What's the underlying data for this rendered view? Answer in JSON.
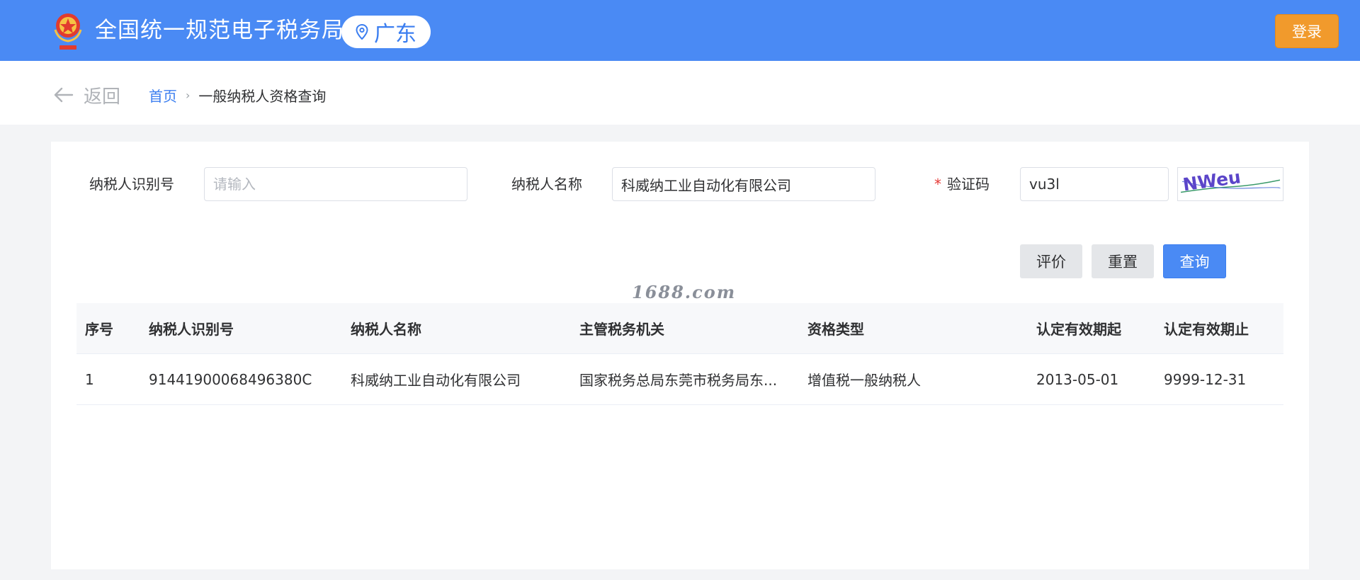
{
  "header": {
    "site_title": "全国统一规范电子税务局",
    "region": "广东",
    "login_label": "登录",
    "brand_color": "#4a8af4"
  },
  "nav": {
    "back_label": "返回",
    "breadcrumb": {
      "home": "首页",
      "separator": "›",
      "current": "一般纳税人资格查询"
    }
  },
  "form": {
    "taxpayer_id": {
      "label": "纳税人识别号",
      "placeholder": "请输入",
      "value": ""
    },
    "taxpayer_name": {
      "label": "纳税人名称",
      "value": "科威纳工业自动化有限公司"
    },
    "captcha": {
      "required_mark": "*",
      "label": "验证码",
      "value": "vu3l",
      "image_text": "NWeu"
    }
  },
  "actions": {
    "evaluate_label": "评价",
    "reset_label": "重置",
    "query_label": "查询"
  },
  "watermark": "1688.com",
  "table": {
    "columns": [
      "序号",
      "纳税人识别号",
      "纳税人名称",
      "主管税务机关",
      "资格类型",
      "认定有效期起",
      "认定有效期止"
    ],
    "rows": [
      [
        "1",
        "91441900068496380C",
        "科威纳工业自动化有限公司",
        "国家税务总局东莞市税务局东...",
        "增值税一般纳税人",
        "2013-05-01",
        "9999-12-31"
      ]
    ]
  }
}
